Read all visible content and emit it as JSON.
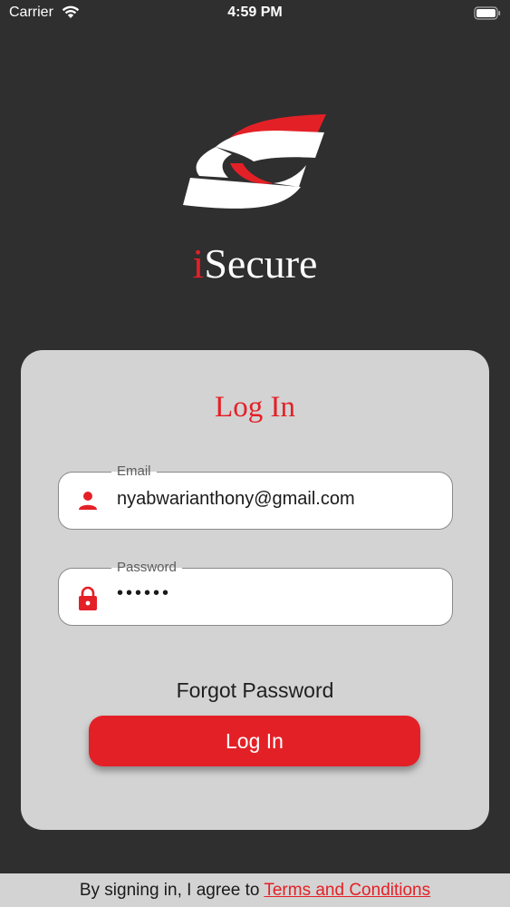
{
  "status_bar": {
    "carrier": "Carrier",
    "time": "4:59 PM",
    "wifi_icon": "wifi-icon",
    "battery_icon": "battery-icon"
  },
  "brand": {
    "logo_icon": "eye-logo-icon",
    "name_accent": "i",
    "name_rest": "Secure",
    "accent_color": "#e42027"
  },
  "login_card": {
    "title": "Log In",
    "email": {
      "label": "Email",
      "value": "nyabwarianthony@gmail.com",
      "icon": "person-icon"
    },
    "password": {
      "label": "Password",
      "value": "••••••",
      "icon": "lock-icon"
    },
    "forgot_label": "Forgot Password",
    "login_button_label": "Log In"
  },
  "footer": {
    "prefix": "By signing in, I agree to ",
    "terms_link": "Terms and Conditions"
  },
  "colors": {
    "background": "#2f2f2f",
    "card": "#d3d3d3",
    "accent": "#e42027"
  }
}
